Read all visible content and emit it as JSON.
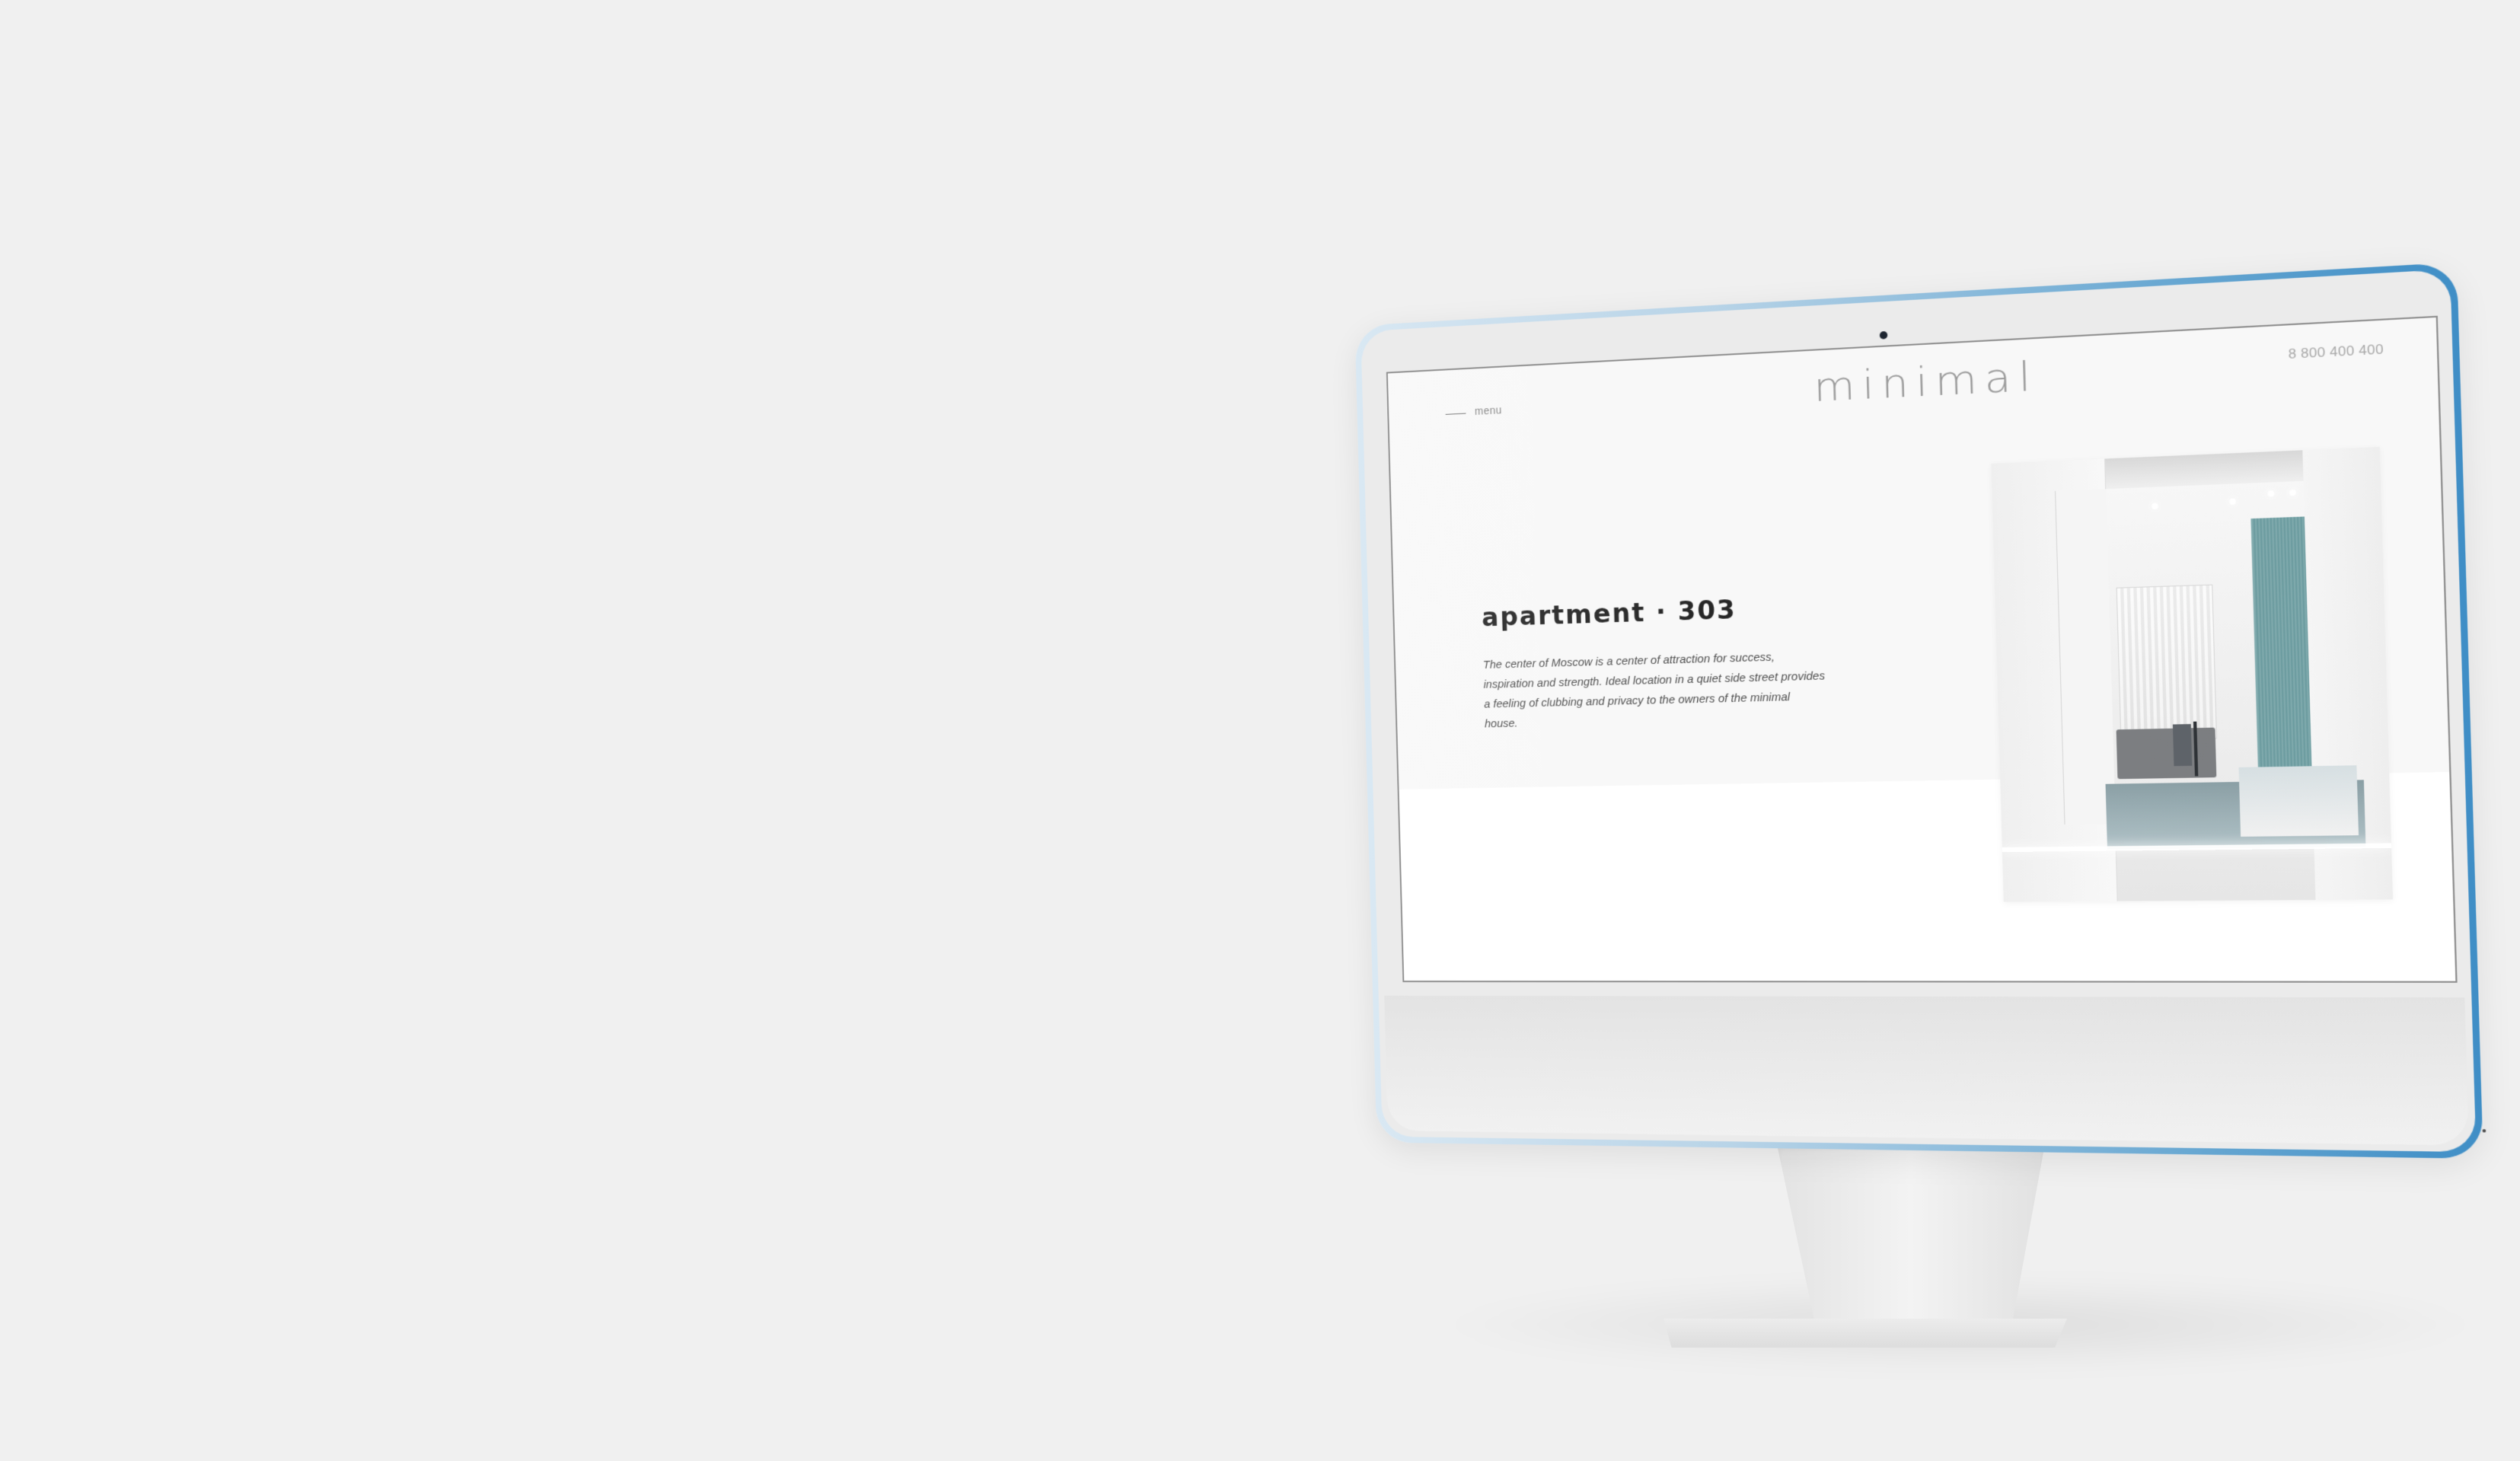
{
  "site": {
    "menu_label": "menu",
    "logo_text": "minimal",
    "phone": "8 800 400 400",
    "hero_title": "apartment · 303",
    "hero_description": "The center of Moscow is a center of attraction for success, inspiration and strength. Ideal location in a quiet side street provides a feeling of clubbing and privacy to the owners of the minimal house."
  },
  "icons": {
    "menu": "menu-line-icon",
    "camera": "camera-icon",
    "power": "power-dot-icon"
  },
  "colors": {
    "page_background": "#f0f0f0",
    "monitor_gradient_start": "#d9e8f3",
    "monitor_gradient_end": "#3f8ec6",
    "screen_background": "#f8f8f8",
    "title_text": "#232323",
    "body_text": "#4a4a4a",
    "muted_text": "#9a9a9a",
    "accent_teal": "#6c9ca0"
  }
}
